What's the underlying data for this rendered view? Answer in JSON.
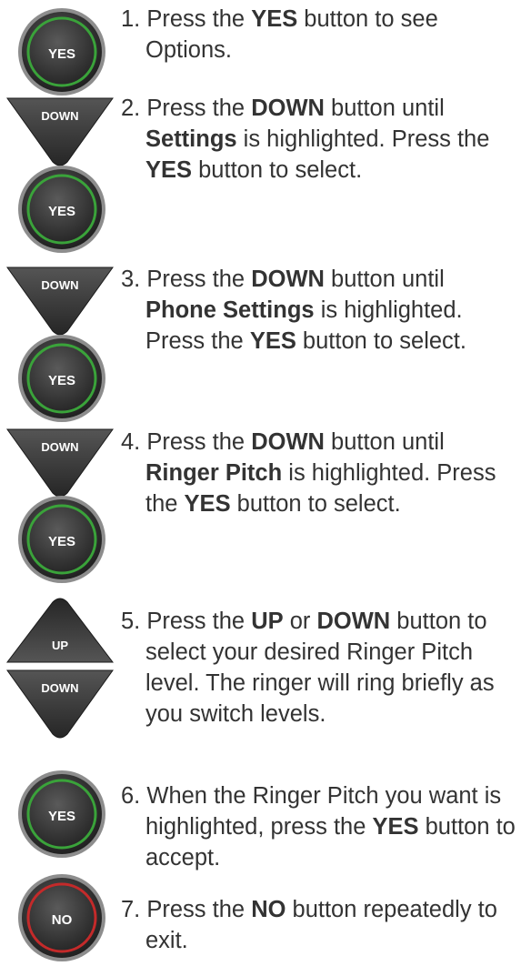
{
  "button_labels": {
    "yes": "YES",
    "no": "NO",
    "up": "UP",
    "down": "DOWN"
  },
  "colors": {
    "button_body": "#3a3a3a",
    "yes_ring": "#3aa33a",
    "no_ring": "#c42a2a",
    "text": "#333333"
  },
  "steps": [
    {
      "number": "1.",
      "parts": [
        "Press the ",
        "YES",
        " button to see Options."
      ],
      "buttons": [
        "yes"
      ]
    },
    {
      "number": "2.",
      "parts": [
        "Press the ",
        "DOWN",
        " button until ",
        "Settings",
        " is highlighted. Press the ",
        "YES",
        " button to select."
      ],
      "buttons": [
        "down",
        "yes"
      ]
    },
    {
      "number": "3.",
      "parts": [
        "Press the ",
        "DOWN",
        " button until ",
        "Phone Settings",
        " is highlighted. Press the ",
        "YES",
        " button to select."
      ],
      "buttons": [
        "down",
        "yes"
      ]
    },
    {
      "number": "4.",
      "parts": [
        "Press the ",
        "DOWN",
        " button until ",
        "Ringer Pitch",
        " is highlighted. Press the ",
        "YES",
        " button to select."
      ],
      "buttons": [
        "down",
        "yes"
      ]
    },
    {
      "number": "5.",
      "parts": [
        "Press the ",
        "UP",
        " or ",
        "DOWN",
        " button to select your desired Ringer Pitch level. The ringer will ring briefly as you switch levels."
      ],
      "buttons": [
        "up",
        "down"
      ]
    },
    {
      "number": "6.",
      "parts": [
        "When the Ringer Pitch you want is highlighted, press the ",
        "YES",
        " button to accept."
      ],
      "buttons": [
        "yes"
      ]
    },
    {
      "number": "7.",
      "parts": [
        "Press the ",
        "NO",
        " button repeatedly to exit."
      ],
      "buttons": [
        "no"
      ]
    }
  ]
}
